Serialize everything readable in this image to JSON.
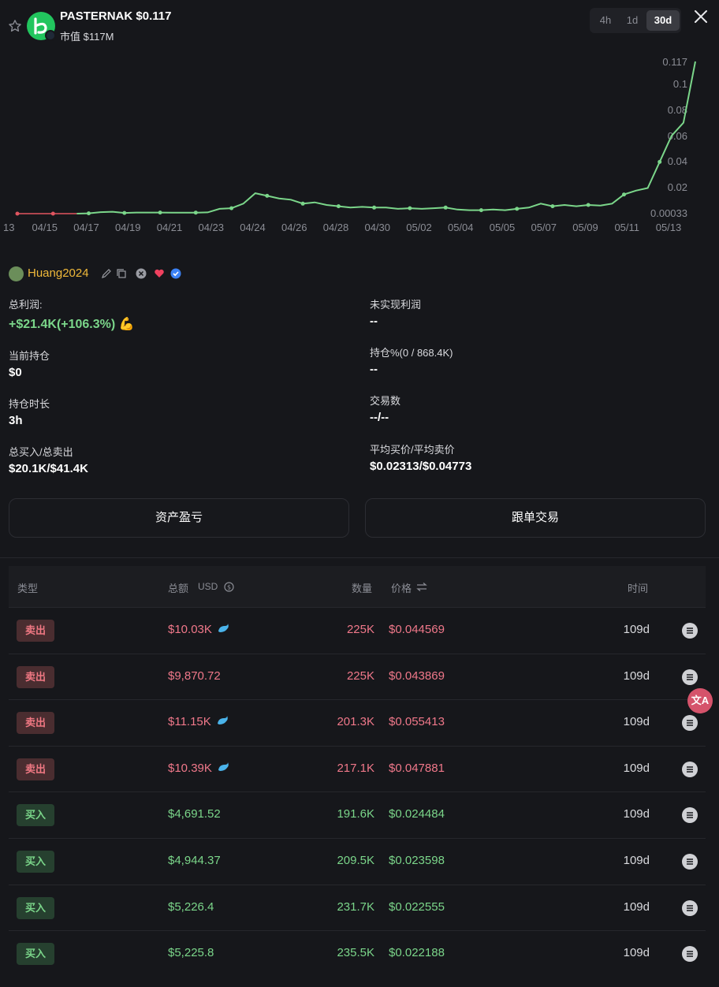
{
  "header": {
    "title": "PASTERNAK $0.117",
    "market_cap": "市值 $117M",
    "timeframes": [
      {
        "label": "4h",
        "active": false
      },
      {
        "label": "1d",
        "active": false
      },
      {
        "label": "30d",
        "active": true
      }
    ]
  },
  "chart_data": {
    "type": "line",
    "x_ticks": [
      "13",
      "04/15",
      "04/17",
      "04/19",
      "04/21",
      "04/23",
      "04/24",
      "04/26",
      "04/28",
      "04/30",
      "05/02",
      "05/04",
      "05/05",
      "05/07",
      "05/09",
      "05/11",
      "05/13"
    ],
    "y_ticks": [
      "0.117",
      "0.1",
      "0.08",
      "0.06",
      "0.04",
      "0.02",
      "0.00033"
    ],
    "ylim": [
      0.00033,
      0.117
    ],
    "series": [
      {
        "values": [
          0.00033,
          0.00033,
          0.00033,
          0.00033,
          0.00033,
          0.00033,
          0.0006,
          0.0015,
          0.0018,
          0.0009,
          0.0012,
          0.0012,
          0.0012,
          0.0011,
          0.0011,
          0.0011,
          0.0013,
          0.004,
          0.0045,
          0.008,
          0.016,
          0.014,
          0.012,
          0.011,
          0.008,
          0.009,
          0.007,
          0.006,
          0.005,
          0.0055,
          0.005,
          0.005,
          0.004,
          0.0045,
          0.004,
          0.0045,
          0.005,
          0.0035,
          0.003,
          0.003,
          0.0035,
          0.003,
          0.004,
          0.005,
          0.008,
          0.006,
          0.007,
          0.006,
          0.007,
          0.0065,
          0.008,
          0.015,
          0.018,
          0.02,
          0.04,
          0.06,
          0.07,
          0.117
        ]
      }
    ],
    "markers": {
      "sell_color": "#e05560",
      "buy_color": "#7bd68a"
    },
    "colors": {
      "line": "#7bd68a",
      "early_line": "#e05560"
    }
  },
  "profile": {
    "username": "Huang2024",
    "stats_left": [
      {
        "label": "总利润:",
        "value": "+$21.4K(+106.3%) 💪",
        "green": true
      },
      {
        "label": "当前持仓",
        "value": "$0",
        "green": false
      },
      {
        "label": "持仓时长",
        "value": "3h",
        "green": false
      },
      {
        "label": "总买入/总卖出",
        "value": "$20.1K/$41.4K",
        "green": false
      }
    ],
    "stats_right": [
      {
        "label": "未实现利润",
        "value": "--"
      },
      {
        "label": "持仓%(0 / 868.4K)",
        "value": "--"
      },
      {
        "label": "交易数",
        "value": "--/--"
      },
      {
        "label": "平均买价/平均卖价",
        "value": "$0.02313/$0.04773"
      }
    ]
  },
  "actions": {
    "pnl_label": "资产盈亏",
    "copy_trade_label": "跟单交易"
  },
  "table": {
    "headers": {
      "type": "类型",
      "amount": "总额",
      "currency": "USD",
      "qty": "数量",
      "price": "价格",
      "time": "时间"
    },
    "rows": [
      {
        "type": "卖出",
        "side": "sell",
        "amount": "$10.03K",
        "whale": true,
        "qty": "225K",
        "price": "$0.044569",
        "time": "109d"
      },
      {
        "type": "卖出",
        "side": "sell",
        "amount": "$9,870.72",
        "whale": false,
        "qty": "225K",
        "price": "$0.043869",
        "time": "109d"
      },
      {
        "type": "卖出",
        "side": "sell",
        "amount": "$11.15K",
        "whale": true,
        "qty": "201.3K",
        "price": "$0.055413",
        "time": "109d"
      },
      {
        "type": "卖出",
        "side": "sell",
        "amount": "$10.39K",
        "whale": true,
        "qty": "217.1K",
        "price": "$0.047881",
        "time": "109d"
      },
      {
        "type": "买入",
        "side": "buy",
        "amount": "$4,691.52",
        "whale": false,
        "qty": "191.6K",
        "price": "$0.024484",
        "time": "109d"
      },
      {
        "type": "买入",
        "side": "buy",
        "amount": "$4,944.37",
        "whale": false,
        "qty": "209.5K",
        "price": "$0.023598",
        "time": "109d"
      },
      {
        "type": "买入",
        "side": "buy",
        "amount": "$5,226.4",
        "whale": false,
        "qty": "231.7K",
        "price": "$0.022555",
        "time": "109d"
      },
      {
        "type": "买入",
        "side": "buy",
        "amount": "$5,225.8",
        "whale": false,
        "qty": "235.5K",
        "price": "$0.022188",
        "time": "109d"
      }
    ]
  },
  "overlay": {
    "translate_label": "文A"
  }
}
